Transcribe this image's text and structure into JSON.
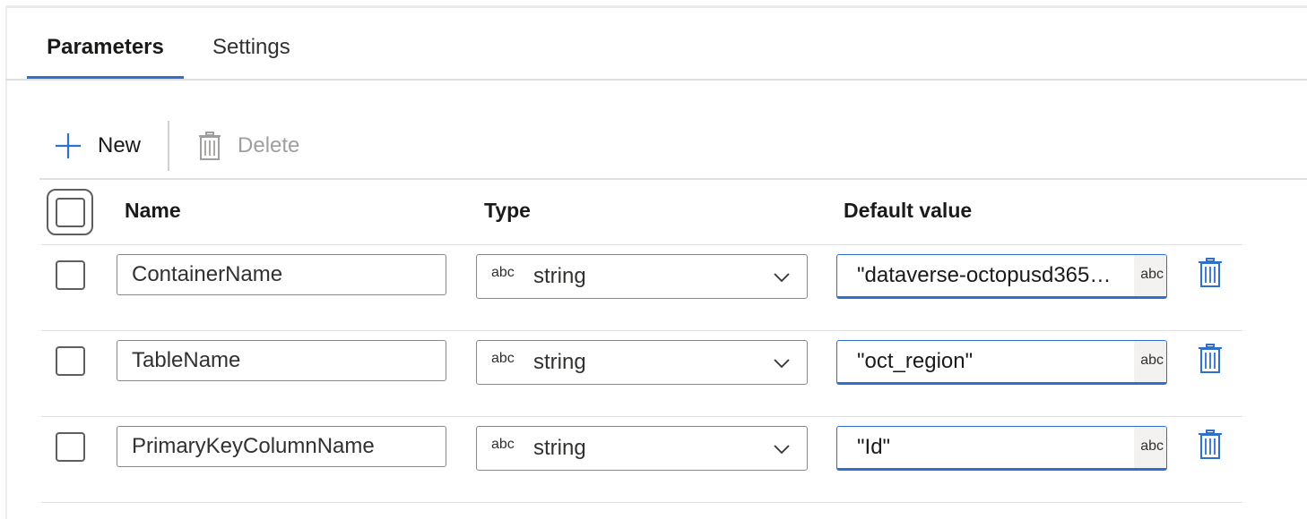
{
  "tabs": [
    {
      "label": "Parameters",
      "active": true
    },
    {
      "label": "Settings",
      "active": false
    }
  ],
  "toolbar": {
    "new_label": "New",
    "delete_label": "Delete"
  },
  "table": {
    "columns": [
      "Name",
      "Type",
      "Default value"
    ],
    "rows": [
      {
        "name": "ContainerName",
        "type_icon": "abc",
        "type": "string",
        "default": "\"dataverse-octopusd365…",
        "default_icon": "abc"
      },
      {
        "name": "TableName",
        "type_icon": "abc",
        "type": "string",
        "default": "\"oct_region\"",
        "default_icon": "abc"
      },
      {
        "name": "PrimaryKeyColumnName",
        "type_icon": "abc",
        "type": "string",
        "default": "\"Id\"",
        "default_icon": "abc"
      }
    ]
  },
  "colors": {
    "accent": "#2f6fd0",
    "delete_icon": "#2f6fd0",
    "disabled": "#a19f9d"
  },
  "icons": {
    "new": "plus-icon",
    "delete": "trash-icon",
    "dropdown": "chevron-down-icon"
  }
}
